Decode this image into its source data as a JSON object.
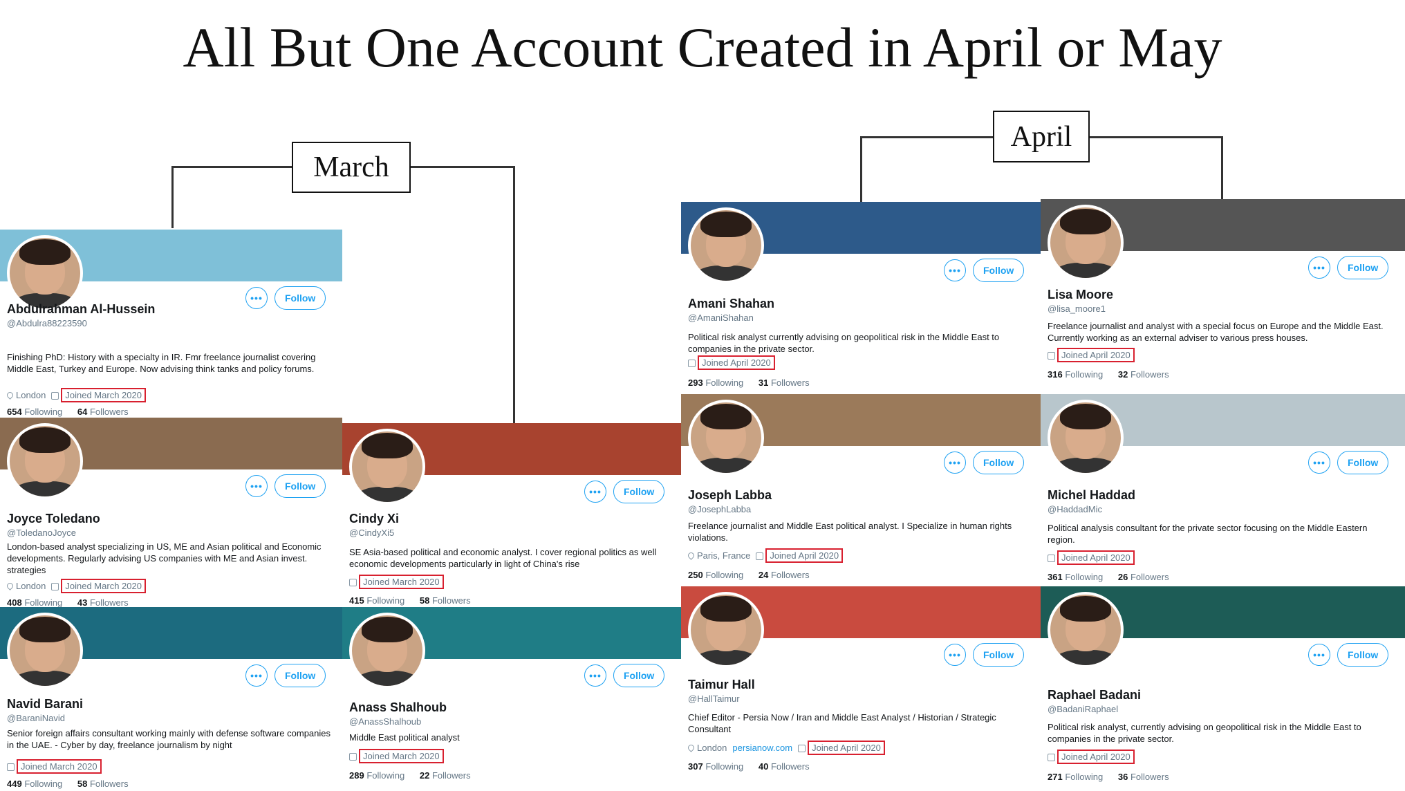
{
  "title": "All But One Account Created in April or May",
  "groups": {
    "march": "March",
    "april": "April"
  },
  "ui": {
    "more": "•••",
    "follow": "Follow",
    "following": "Following",
    "followers": "Followers"
  },
  "profiles": [
    {
      "name": "Abdulrahman Al-Hussein",
      "handle": "@Abdulra88223590",
      "bio": "Finishing PhD: History with a specialty in IR. Fmr freelance journalist covering Middle East, Turkey and Europe. Now advising think tanks and policy forums.",
      "location": "London",
      "link": "",
      "joined": "Joined March 2020",
      "following": "654",
      "followers": "64",
      "banner": "#7fc0d8"
    },
    {
      "name": "Joyce Toledano",
      "handle": "@ToledanoJoyce",
      "bio": "London-based analyst specializing in US, ME and Asian political and Economic developments. Regularly advising US companies with ME and Asian invest. strategies",
      "location": "London",
      "link": "",
      "joined": "Joined March 2020",
      "following": "408",
      "followers": "43",
      "banner": "#8a6b50"
    },
    {
      "name": "Navid Barani",
      "handle": "@BaraniNavid",
      "bio": "Senior foreign affairs consultant working mainly with defense software companies in the UAE. - Cyber by day, freelance journalism by night",
      "location": "",
      "link": "",
      "joined": "Joined March 2020",
      "following": "449",
      "followers": "58",
      "banner": "#1c6b7f"
    },
    {
      "name": "Cindy Xi",
      "handle": "@CindyXi5",
      "bio": "SE Asia-based political and economic analyst. I cover regional politics as well economic developments particularly in light of China's rise",
      "location": "",
      "link": "",
      "joined": "Joined March 2020",
      "following": "415",
      "followers": "58",
      "banner": "#a8432f"
    },
    {
      "name": "Anass Shalhoub",
      "handle": "@AnassShalhoub",
      "bio": "Middle East political analyst",
      "location": "",
      "link": "",
      "joined": "Joined March 2020",
      "following": "289",
      "followers": "22",
      "banner": "#1f7d86"
    },
    {
      "name": "Amani Shahan",
      "handle": "@AmaniShahan",
      "bio": "Political risk analyst currently advising on geopolitical risk in the Middle East to companies in the private sector.",
      "location": "",
      "link": "",
      "joined": "Joined April 2020",
      "following": "293",
      "followers": "31",
      "banner": "#2d5a8a"
    },
    {
      "name": "Joseph Labba",
      "handle": "@JosephLabba",
      "bio": "Freelance journalist and Middle East political analyst. I Specialize in human rights violations.",
      "location": "Paris, France",
      "link": "",
      "joined": "Joined April 2020",
      "following": "250",
      "followers": "24",
      "banner": "#9b7a5a"
    },
    {
      "name": "Taimur Hall",
      "handle": "@HallTaimur",
      "bio": "Chief Editor - Persia Now / Iran and Middle East Analyst / Historian / Strategic Consultant",
      "location": "London",
      "link": "persianow.com",
      "joined": "Joined April 2020",
      "following": "307",
      "followers": "40",
      "banner": "#c94b3f"
    },
    {
      "name": "Lisa Moore",
      "handle": "@lisa_moore1",
      "bio": "Freelance journalist and analyst with a special focus on Europe and the Middle East. Currently working as an external adviser to various press houses.",
      "location": "",
      "link": "",
      "joined": "Joined April 2020",
      "following": "316",
      "followers": "32",
      "banner": "#555555"
    },
    {
      "name": "Michel Haddad",
      "handle": "@HaddadMic",
      "bio": "Political analysis consultant for the private sector focusing on the Middle Eastern region.",
      "location": "",
      "link": "",
      "joined": "Joined April 2020",
      "following": "361",
      "followers": "26",
      "banner": "#b8c6cc"
    },
    {
      "name": "Raphael Badani",
      "handle": "@BadaniRaphael",
      "bio": "Political risk analyst, currently advising on geopolitical risk in the Middle East to companies in the private sector.",
      "location": "",
      "link": "",
      "joined": "Joined April 2020",
      "following": "271",
      "followers": "36",
      "banner": "#1d5c56"
    }
  ]
}
